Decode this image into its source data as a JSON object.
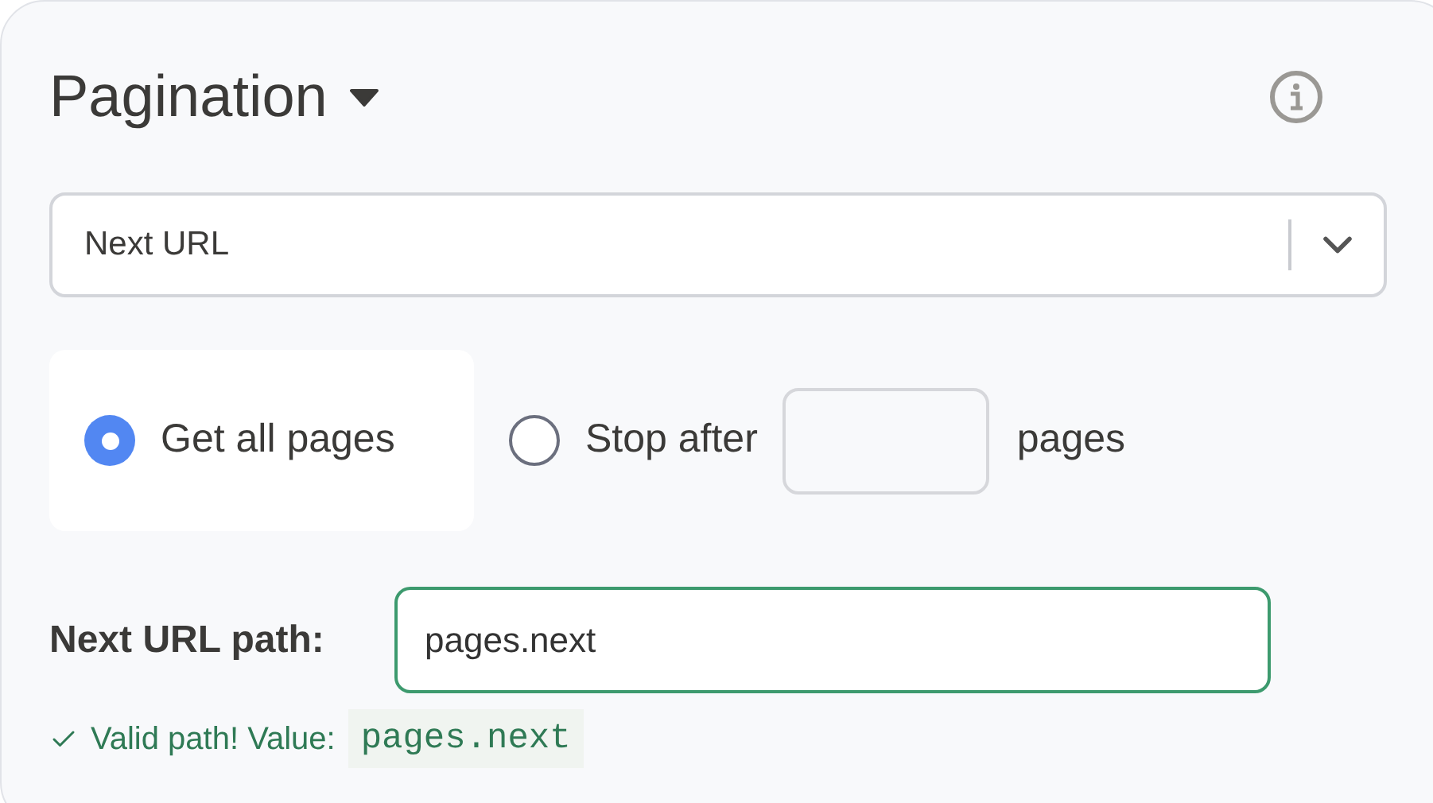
{
  "section": {
    "title": "Pagination",
    "expanded": true
  },
  "strategy_select": {
    "value": "Next URL"
  },
  "page_options": [
    {
      "kind": "all",
      "label": "Get all pages",
      "selected": true
    },
    {
      "kind": "limit",
      "label": "Stop after",
      "suffix": "pages",
      "selected": false
    }
  ],
  "next_url_path": {
    "label": "Next URL path:",
    "value": "pages.next"
  },
  "validation": {
    "message": "Valid path! Value:",
    "value": "pages.next"
  }
}
